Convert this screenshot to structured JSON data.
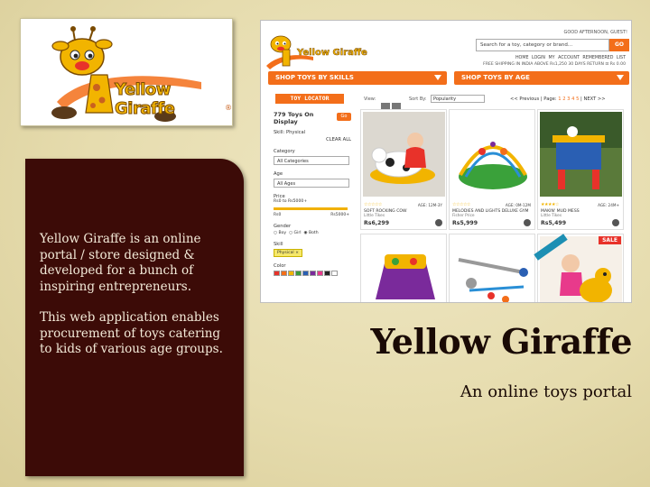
{
  "logo": {
    "wordmark": "Yellow Giraffe",
    "reg_mark": "®"
  },
  "description": {
    "paragraph_1": "Yellow Giraffe is an online portal / store designed & developed for a bunch of inspiring entrepreneurs.",
    "paragraph_2": "This web application enables procurement of  toys catering to kids of various age groups."
  },
  "title": "Yellow Giraffe",
  "subtitle": "An online toys portal",
  "screenshot": {
    "logo_word": "Yellow Giraffe",
    "greeting": "GOOD AFTERNOON, GUEST!",
    "search_placeholder": "Search for a toy, category or brand...",
    "search_button": "GO",
    "top_links": "HOME   LOGIN   MY ACCOUNT   REMEMBERED LIST",
    "shipping_note": "FREE SHIPPING IN INDIA ABOVE Rs1,250    30 DAYS RETURN    ⊡ Rs 0.00",
    "nav_skills": "SHOP TOYS BY SKILLS",
    "nav_age": "SHOP TOYS BY AGE",
    "toy_locator": "TOY LOCATOR",
    "view_label": "View:",
    "sort_label": "Sort By:",
    "sort_value": "Popularity",
    "pager_prefix": "<< Previous | Page:",
    "pager_pages": "1  2  3  4  5",
    "pager_next": "| NEXT >>",
    "sidebar": {
      "count_text": "779 Toys On Display",
      "go_button": "Go",
      "skill_filter": "Skill: Physical",
      "clear_all": "CLEAR ALL",
      "category_label": "Category",
      "category_value": "All Categories",
      "age_label": "Age",
      "age_value": "All Ages",
      "price_label": "Price",
      "price_range": "Rs0 to Rs5000+",
      "price_min": "Rs0",
      "price_max": "Rs5000+",
      "gender_label": "Gender",
      "gender_boy": "○ Boy",
      "gender_girl": "○ Girl",
      "gender_both": "◉ Both",
      "skill_label": "Skill",
      "skill_tag": "Physical  ×",
      "color_label": "Color",
      "colors": [
        "#e8322a",
        "#f36e1a",
        "#f2b400",
        "#3a9b3a",
        "#2a5fb3",
        "#7a2a9b",
        "#e83a8b",
        "#222222",
        "#ffffff"
      ]
    },
    "products": [
      {
        "name": "SOFT ROCKING COW",
        "brand": "Little Tikes",
        "price": "Rs6,299",
        "age": "AGE: 12M-3Y",
        "stars": "☆☆☆☆☆"
      },
      {
        "name": "MELODIES AND LIGHTS DELUXE GYM",
        "brand": "Fisher Price",
        "price": "Rs5,999",
        "age": "AGE: 0M-12M",
        "stars": "☆☆☆☆☆"
      },
      {
        "name": "MAKIN' MUD MESS",
        "brand": "Little Tikes",
        "price": "Rs5,499",
        "age": "AGE: 24M+",
        "stars": "★★★★☆"
      }
    ],
    "sale_badge": "SALE"
  }
}
